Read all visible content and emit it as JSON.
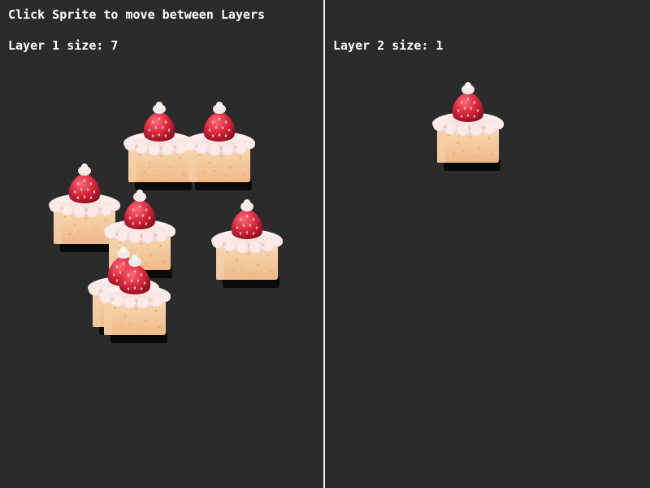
{
  "instructions": "Click Sprite to move between Layers",
  "layers": [
    {
      "label": "Layer 1 size: 7"
    },
    {
      "label": "Layer 2 size: 1"
    }
  ],
  "sprite_icon": "strawberry-cake-icon",
  "colors": {
    "background": "#2b2b2b",
    "divider": "#f2f2f2",
    "text": "#ffffff",
    "strawberry": "#d7263d",
    "cream": "#f6e4e0",
    "sponge": "#f2c89a",
    "shadow": "#0a0a0a"
  }
}
